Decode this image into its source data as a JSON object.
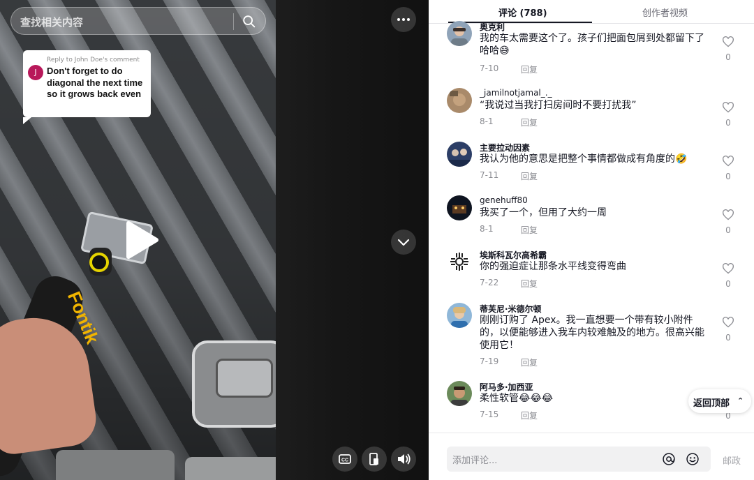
{
  "search": {
    "placeholder": "查找相关内容"
  },
  "reply_card": {
    "header": "Reply to John Doe's comment",
    "avatar_letter": "J",
    "text": "Don't forget to do diagonal the next time so it grows back even"
  },
  "video": {
    "brand_text": "Fontik"
  },
  "tabs": {
    "comments": "评论 (788)",
    "creator_videos": "创作者视频"
  },
  "reply_label": "回复",
  "comments": [
    {
      "user": "奥克利",
      "text": "我的车太需要这个了。孩子们把面包屑到处都留下了哈哈😅",
      "date": "7-10",
      "likes": "0"
    },
    {
      "user": "_jamilnotjamal_._",
      "text": "“我说过当我打扫房间时不要打扰我”",
      "date": "8-1",
      "likes": "0"
    },
    {
      "user": "主要拉动因素",
      "text": "我认为他的意思是把整个事情都做成有角度的🤣",
      "date": "7-11",
      "likes": "0"
    },
    {
      "user": "genehuff80",
      "text": "我买了一个，但用了大约一周",
      "date": "8-1",
      "likes": "0"
    },
    {
      "user": "埃斯科瓦尔高希霸",
      "text": "你的强迫症让那条水平线变得弯曲",
      "date": "7-22",
      "likes": "0"
    },
    {
      "user": "蒂芙尼·米德尔顿",
      "text": "刚刚订购了 Apex。我一直想要一个带有较小附件的，以便能够进入我车内较难触及的地方。很高兴能使用它！",
      "date": "7-19",
      "likes": "0"
    },
    {
      "user": "阿马多·加西亚",
      "text": "柔性软管😂😂😂",
      "date": "7-15",
      "likes": "0"
    }
  ],
  "back_to_top": "返回顶部",
  "comment_input": {
    "placeholder": "添加评论..."
  },
  "post_label": "邮政"
}
